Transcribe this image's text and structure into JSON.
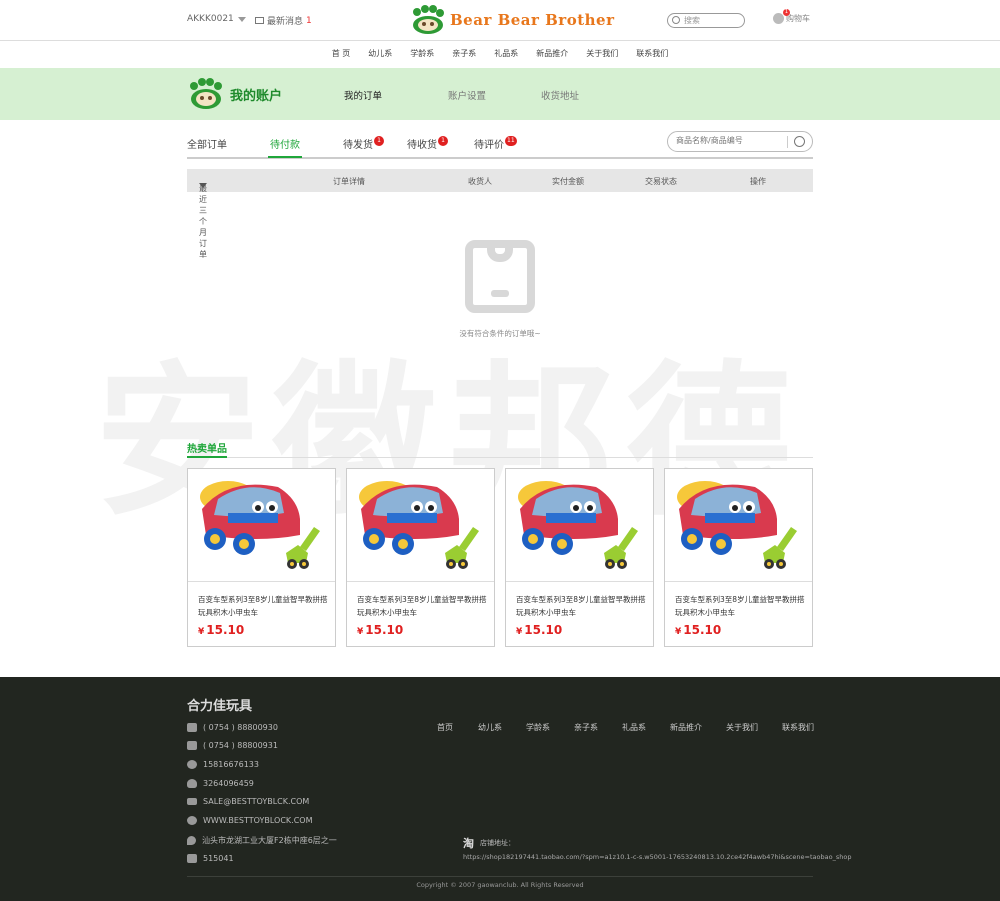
{
  "header": {
    "account": "AKKK0021",
    "messages_label": "最新消息",
    "messages_count": "1",
    "logo_text": "Bear Bear Brother",
    "search_placeholder": "搜索",
    "cart_label": "购物车",
    "cart_count": "1"
  },
  "nav": [
    "首 页",
    "幼儿系",
    "学龄系",
    "亲子系",
    "礼品系",
    "新品推介",
    "关于我们",
    "联系我们"
  ],
  "account_banner": {
    "title": "我的账户",
    "tabs": [
      "我的订单",
      "账户设置",
      "收货地址"
    ]
  },
  "order_tabs": [
    {
      "label": "全部订单",
      "badge": ""
    },
    {
      "label": "待付款",
      "badge": ""
    },
    {
      "label": "待发货",
      "badge": "1"
    },
    {
      "label": "待收货",
      "badge": "1"
    },
    {
      "label": "待评价",
      "badge": "11"
    }
  ],
  "order_search_placeholder": "商品名称/商品编号",
  "table_headers": [
    "最近三个月订单",
    "订单详情",
    "收货人",
    "实付金额",
    "交易状态",
    "操作"
  ],
  "empty_text": "没有符合条件的订单哦~",
  "watermark": "安徽邦德",
  "hot": {
    "title": "热卖单品",
    "products": [
      {
        "name": "百变车型系列3至8岁儿童益智早教拼搭玩具积木小甲虫车",
        "currency": "¥",
        "price": "15.10"
      },
      {
        "name": "百变车型系列3至8岁儿童益智早教拼搭玩具积木小甲虫车",
        "currency": "¥",
        "price": "15.10"
      },
      {
        "name": "百变车型系列3至8岁儿童益智早教拼搭玩具积木小甲虫车",
        "currency": "¥",
        "price": "15.10"
      },
      {
        "name": "百变车型系列3至8岁儿童益智早教拼搭玩具积木小甲虫车",
        "currency": "¥",
        "price": "15.10"
      }
    ]
  },
  "footer": {
    "company": "合力佳玩具",
    "contacts": [
      {
        "icon": "phone-icon",
        "text": "( 0754 ) 88800930"
      },
      {
        "icon": "fax-icon",
        "text": "( 0754 ) 88800931"
      },
      {
        "icon": "wechat-icon",
        "text": "15816676133"
      },
      {
        "icon": "qq-icon",
        "text": "3264096459"
      },
      {
        "icon": "email-icon",
        "text": "SALE@BESTTOYBLCK.COM"
      },
      {
        "icon": "globe-icon",
        "text": "WWW.BESTTOYBLOCK.COM"
      },
      {
        "icon": "location-icon",
        "text": "汕头市龙湖工业大厦F2栋中座6层之一"
      },
      {
        "icon": "postcode-icon",
        "text": "515041"
      }
    ],
    "nav": [
      "首页",
      "幼儿系",
      "学龄系",
      "亲子系",
      "礼品系",
      "新品推介",
      "关于我们",
      "联系我们"
    ],
    "taobao_glyph": "淘",
    "taobao_label": "店铺地址：",
    "taobao_url": "https://shop182197441.taobao.com/?spm=a1z10.1-c-s.w5001-17653240813.10.2ce42f4awb47hi&scene=taobao_shop",
    "copyright": "Copyright © 2007 gaowanclub. All Rights Reserved"
  },
  "colors": {
    "accent_green": "#1fa63a",
    "banner_bg": "#d6f0d2",
    "price_red": "#e02020",
    "footer_bg": "#222620",
    "logo_orange": "#e8771c"
  }
}
